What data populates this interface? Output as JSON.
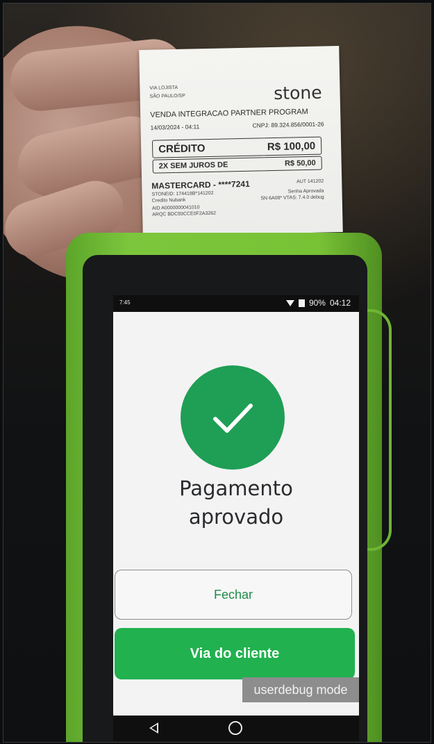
{
  "receipt": {
    "store_line": "VIA LOJISTA",
    "city": "SÃO PAULO/SP",
    "brand": "stone",
    "sale_line": "VENDA  INTEGRACAO PARTNER PROGRAM",
    "date_line": "14/03/2024 - 04:11",
    "cnpj_line": "CNPJ: 89.324.856/0001-26",
    "credit_label": "CRÉDITO",
    "credit_value": "R$ 100,00",
    "installment_label": "2X SEM JUROS DE",
    "installment_value": "R$ 50,00",
    "card_line": "MASTERCARD - ****7241",
    "aut_line": "AUT 141202",
    "stoneid_line": "STONEID: 174418B*141202",
    "senha_line": "Senha Aprovada",
    "credito_nubank": "Credito Nubank",
    "sn_line": "SN 6A08* VTAS: 7.4.0 debug",
    "aid_line": "AID A0000000041010",
    "arqc_line": "ARQC BDC93CCE0F2A3262"
  },
  "device": {
    "status_left": "7:45",
    "battery_percent": "90%",
    "clock": "04:12",
    "icons": [
      "wifi-icon",
      "battery-icon",
      "check-icon",
      "back-icon",
      "home-icon"
    ],
    "title_line1": "Pagamento",
    "title_line2": "aprovado",
    "close_button_label": "Fechar",
    "customer_copy_button_label": "Via do cliente",
    "debug_label": "userdebug mode",
    "colors": {
      "success_green": "#1f9e55",
      "primary_button": "#21b14f",
      "terminal_body": "#78c236"
    }
  }
}
